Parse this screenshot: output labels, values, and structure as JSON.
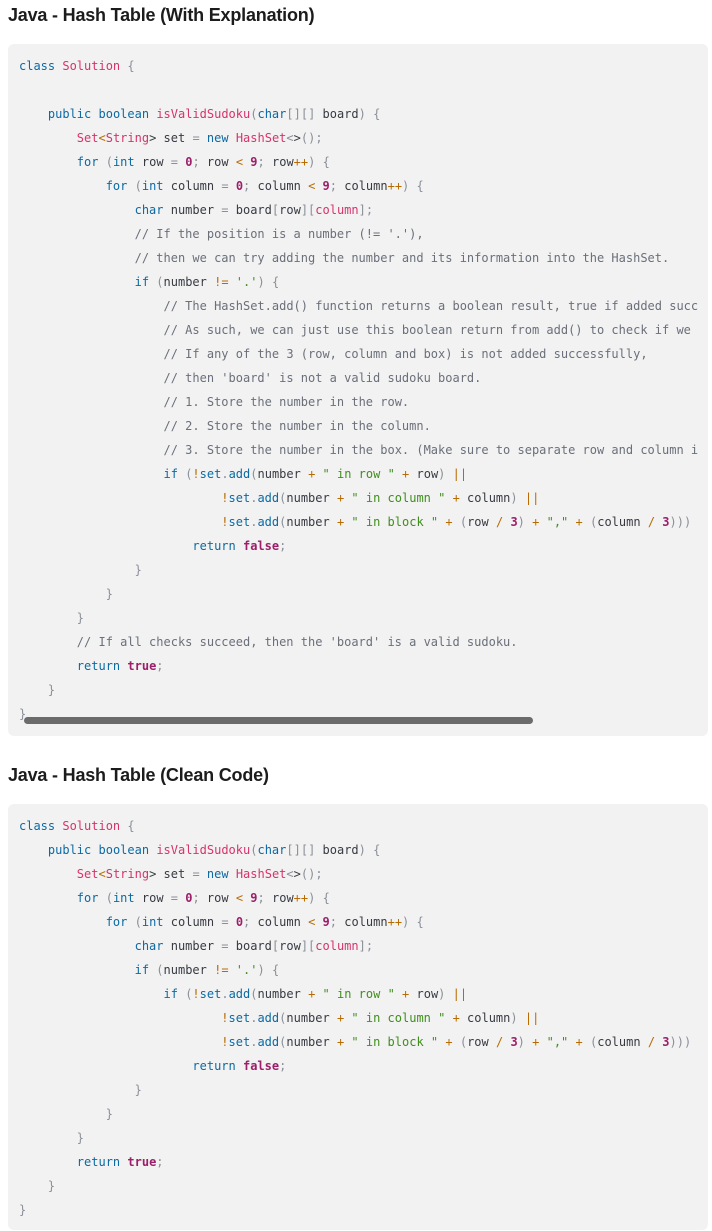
{
  "sections": [
    {
      "title": "Java - Hash Table (With Explanation)",
      "lines": [
        "class Solution {",
        "",
        "    public boolean isValidSudoku(char[][] board) {",
        "        Set<String> set = new HashSet<>();",
        "        for (int row = 0; row < 9; row++) {",
        "            for (int column = 0; column < 9; column++) {",
        "                char number = board[row][column];",
        "                // If the position is a number (!= '.'),",
        "                // then we can try adding the number and its information into the HashSet.",
        "                if (number != '.') {",
        "                    // The HashSet.add() function returns a boolean result, true if added succ",
        "                    // As such, we can just use this boolean return from add() to check if we",
        "                    // If any of the 3 (row, column and box) is not added successfully,",
        "                    // then 'board' is not a valid sudoku board.",
        "                    // 1. Store the number in the row.",
        "                    // 2. Store the number in the column.",
        "                    // 3. Store the number in the box. (Make sure to separate row and column i",
        "                    if (!set.add(number + \" in row \" + row) ||",
        "                            !set.add(number + \" in column \" + column) ||",
        "                            !set.add(number + \" in block \" + (row / 3) + \",\" + (column / 3)))",
        "                        return false;",
        "                }",
        "            }",
        "        }",
        "        // If all checks succeed, then the 'board' is a valid sudoku.",
        "        return true;",
        "    }",
        "}"
      ]
    },
    {
      "title": "Java - Hash Table (Clean Code)",
      "lines": [
        "class Solution {",
        "    public boolean isValidSudoku(char[][] board) {",
        "        Set<String> set = new HashSet<>();",
        "        for (int row = 0; row < 9; row++) {",
        "            for (int column = 0; column < 9; column++) {",
        "                char number = board[row][column];",
        "                if (number != '.') {",
        "                    if (!set.add(number + \" in row \" + row) ||",
        "                            !set.add(number + \" in column \" + column) ||",
        "                            !set.add(number + \" in block \" + (row / 3) + \",\" + (column / 3)))",
        "                        return false;",
        "                }",
        "            }",
        "        }",
        "        return true;",
        "    }",
        "}"
      ]
    }
  ]
}
